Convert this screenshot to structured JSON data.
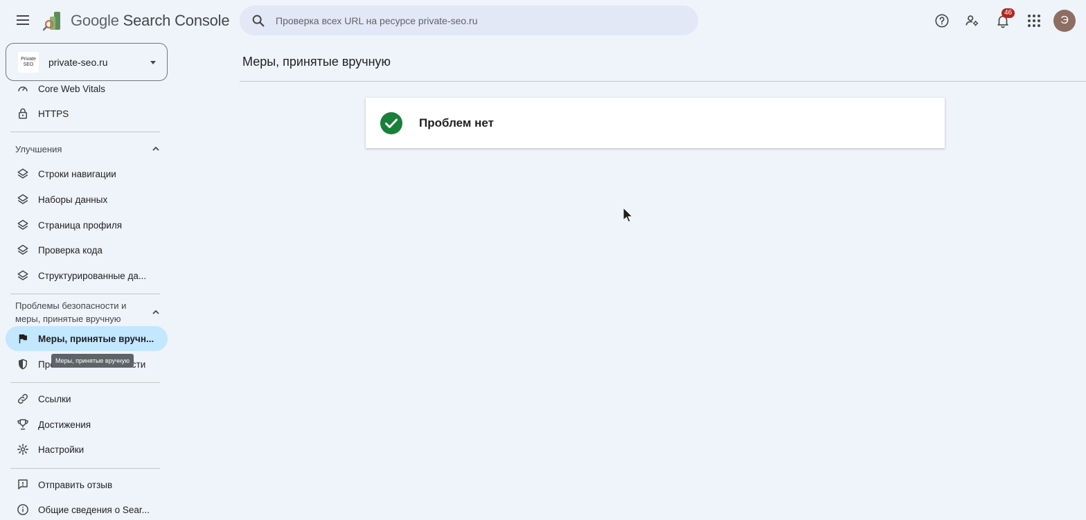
{
  "app": {
    "title_google": "Google",
    "title_product": "Search Console"
  },
  "search": {
    "placeholder": "Проверка всех URL на ресурсе private-seo.ru"
  },
  "header": {
    "notifications_count": "46",
    "avatar_letter": "Э"
  },
  "property": {
    "logo_text": "Private SEO",
    "name": "private-seo.ru"
  },
  "sidebar": {
    "top_items": [
      {
        "label": "Core Web Vitals",
        "icon": "speedometer-icon"
      },
      {
        "label": "HTTPS",
        "icon": "lock-icon"
      }
    ],
    "enhancements": {
      "header": "Улучшения",
      "items": [
        {
          "label": "Строки навигации",
          "icon": "layers-icon"
        },
        {
          "label": "Наборы данных",
          "icon": "layers-icon"
        },
        {
          "label": "Страница профиля",
          "icon": "layers-icon"
        },
        {
          "label": "Проверка кода",
          "icon": "layers-icon"
        },
        {
          "label": "Структурированные да...",
          "icon": "layers-icon"
        }
      ]
    },
    "security": {
      "header_line1": "Проблемы безопасности и",
      "header_line2": "меры, принятые вручную",
      "items": [
        {
          "label": "Меры, принятые вручн...",
          "icon": "flag-icon",
          "active": true
        },
        {
          "label": "Проблемы безопасности",
          "icon": "shield-icon"
        }
      ],
      "tooltip": "Меры, принятые вручную"
    },
    "misc_items": [
      {
        "label": "Ссылки",
        "icon": "link-icon"
      },
      {
        "label": "Достижения",
        "icon": "trophy-icon"
      },
      {
        "label": "Настройки",
        "icon": "gear-icon"
      }
    ],
    "footer_items": [
      {
        "label": "Отправить отзыв",
        "icon": "feedback-icon"
      },
      {
        "label": "Общие сведения о Sear...",
        "icon": "info-icon"
      }
    ]
  },
  "main": {
    "page_title": "Меры, принятые вручную",
    "status_text": "Проблем нет"
  },
  "colors": {
    "background": "#eff3fa",
    "active_nav": "#c2e7ff",
    "success_green": "#188038",
    "badge_red": "#b3261e"
  }
}
